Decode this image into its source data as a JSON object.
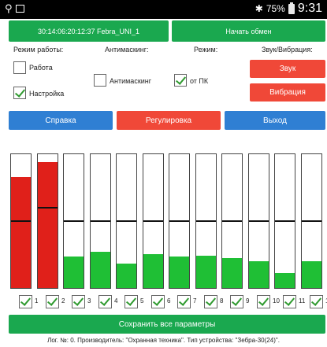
{
  "status_bar": {
    "usb_icon": "usb-icon",
    "bluetooth_icon": "bluetooth-icon",
    "battery": "75%",
    "time": "9:31"
  },
  "top": {
    "device_label": "30:14:06:20:12:37 Febra_UNI_1",
    "exchange_button": "Начать обмен"
  },
  "labels": {
    "mode_work": "Режим работы:",
    "antimasking": "Антимаскинг:",
    "mode": "Режим:",
    "sound_vibration": "Звук/Вибрация:"
  },
  "checkboxes": {
    "work": {
      "label": "Работа",
      "checked": false
    },
    "setup": {
      "label": "Настройка",
      "checked": true
    },
    "antimask": {
      "label": "Антимаскинг",
      "checked": false
    },
    "from_pc": {
      "label": "от ПК",
      "checked": true
    }
  },
  "buttons": {
    "sound": "Звук",
    "vibration": "Вибрация",
    "help": "Справка",
    "adjust": "Регулировка",
    "exit": "Выход",
    "save_all": "Сохранить все параметры"
  },
  "colors": {
    "green": "#1aa84f",
    "red": "#f04838",
    "blue": "#2f7fd3",
    "bar_green": "#1fbf35",
    "bar_red": "#e0201a"
  },
  "channels": [
    {
      "number": "1",
      "checked": true,
      "level": 0.82,
      "threshold": 0.49,
      "state": "alarm"
    },
    {
      "number": "2",
      "checked": true,
      "level": 0.93,
      "threshold": 0.59,
      "state": "alarm"
    },
    {
      "number": "3",
      "checked": true,
      "level": 0.23,
      "threshold": 0.49,
      "state": "normal"
    },
    {
      "number": "4",
      "checked": true,
      "level": 0.27,
      "threshold": 0.49,
      "state": "normal"
    },
    {
      "number": "5",
      "checked": true,
      "level": 0.18,
      "threshold": 0.49,
      "state": "normal"
    },
    {
      "number": "6",
      "checked": true,
      "level": 0.25,
      "threshold": 0.49,
      "state": "normal"
    },
    {
      "number": "7",
      "checked": true,
      "level": 0.23,
      "threshold": 0.49,
      "state": "normal"
    },
    {
      "number": "8",
      "checked": true,
      "level": 0.24,
      "threshold": 0.49,
      "state": "normal"
    },
    {
      "number": "9",
      "checked": true,
      "level": 0.22,
      "threshold": 0.49,
      "state": "normal"
    },
    {
      "number": "10",
      "checked": true,
      "level": 0.2,
      "threshold": 0.49,
      "state": "normal"
    },
    {
      "number": "11",
      "checked": true,
      "level": 0.11,
      "threshold": 0.49,
      "state": "normal"
    },
    {
      "number": "12",
      "checked": true,
      "level": 0.2,
      "threshold": 0.49,
      "state": "normal"
    }
  ],
  "footer": "Лог. №: 0. Производитель: \"Охранная техника\". Тип устройства: \"Зебра-30(24)\"."
}
